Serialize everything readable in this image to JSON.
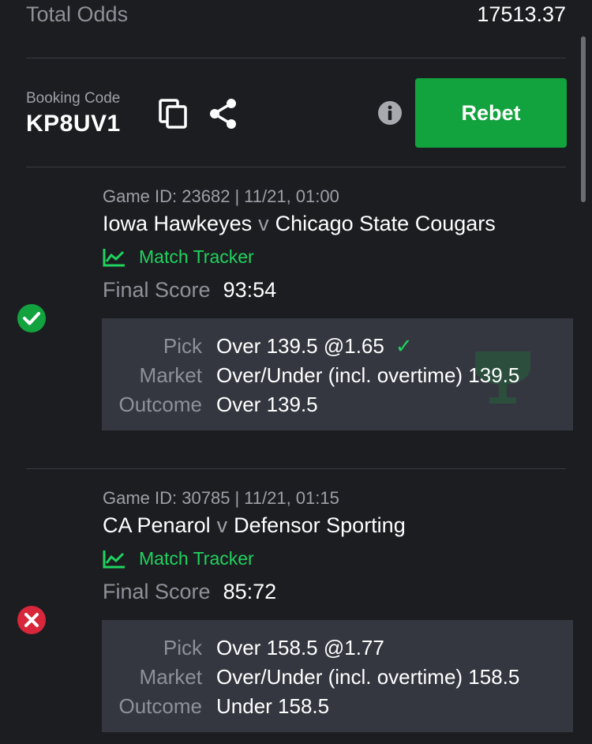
{
  "summary": {
    "total_odds_label": "Total Odds",
    "total_odds_value": "17513.37"
  },
  "booking": {
    "label": "Booking Code",
    "code": "KP8UV1",
    "rebet_label": "Rebet"
  },
  "colors": {
    "accent_green": "#12a23e",
    "tracker_green": "#1fd35e",
    "loss_red": "#d8263a",
    "background": "#1c1d21",
    "panel": "#353740"
  },
  "bets": [
    {
      "game_id_label": "Game ID: 23682",
      "datetime": "11/21, 01:00",
      "home": "Iowa Hawkeyes",
      "vs": "v",
      "away": "Chicago State Cougars",
      "tracker_label": "Match Tracker",
      "final_score_label": "Final Score",
      "final_score": "93:54",
      "status": "won",
      "status_icon": "check-circle-icon",
      "pick_label": "Pick",
      "pick": "Over 139.5 @1.65",
      "market_label": "Market",
      "market": "Over/Under (incl. overtime) 139.5",
      "outcome_label": "Outcome",
      "outcome": "Over 139.5"
    },
    {
      "game_id_label": "Game ID: 30785",
      "datetime": "11/21, 01:15",
      "home": "CA Penarol",
      "vs": "v",
      "away": "Defensor Sporting",
      "tracker_label": "Match Tracker",
      "final_score_label": "Final Score",
      "final_score": "85:72",
      "status": "lost",
      "status_icon": "x-circle-icon",
      "pick_label": "Pick",
      "pick": "Over 158.5 @1.77",
      "market_label": "Market",
      "market": "Over/Under (incl. overtime) 158.5",
      "outcome_label": "Outcome",
      "outcome": "Under 158.5"
    }
  ]
}
